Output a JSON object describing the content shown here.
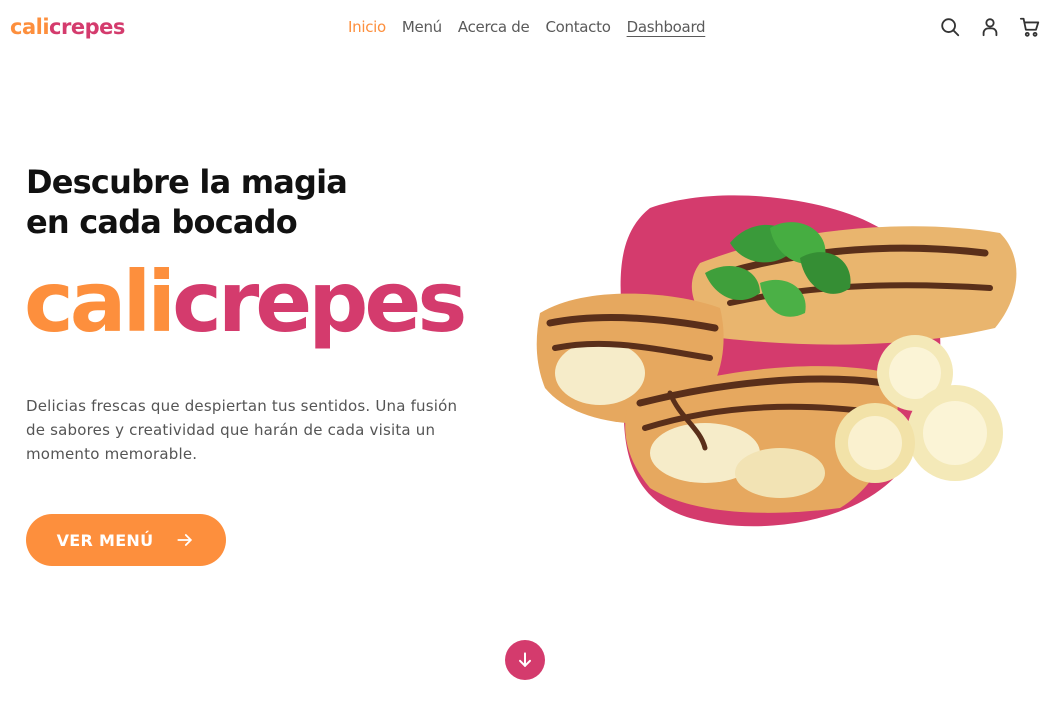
{
  "logo": {
    "part1": "cali",
    "part2": "crepes"
  },
  "nav": {
    "items": [
      {
        "label": "Inicio"
      },
      {
        "label": "Menú"
      },
      {
        "label": "Acerca de"
      },
      {
        "label": "Contacto"
      },
      {
        "label": "Dashboard"
      }
    ]
  },
  "header_icons": [
    "search-icon",
    "user-icon",
    "cart-icon"
  ],
  "hero": {
    "headline_line1": "Descubre la magia",
    "headline_line2": "en cada bocado",
    "brand_part1": "cali",
    "brand_part2": "crepes",
    "description": "Delicias frescas que despiertan tus sentidos. Una fusión de sabores y creatividad que harán de cada visita un momento memorable.",
    "cta_label": "VER MENÚ",
    "cta_icon": "arrow-right-icon",
    "scroll_icon": "arrow-down-icon"
  },
  "colors": {
    "accent_orange": "#fd8f3d",
    "accent_pink": "#d43b6d",
    "text_dark": "#111111",
    "text_muted": "#555555"
  }
}
